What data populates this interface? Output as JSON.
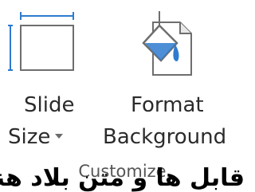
{
  "ribbon_group": {
    "name": "Customize",
    "buttons": [
      {
        "id": "slide_size",
        "icon": "slide-frame-icon",
        "label_line1": "Slide",
        "label_line2": "Size",
        "has_dropdown": true
      },
      {
        "id": "format_background",
        "icon": "paint-bucket-page-icon",
        "label_line1": "Format",
        "label_line2": "Background",
        "has_dropdown": false
      }
    ]
  },
  "overlay_caption": "قابل ها و متن بلاد هنا",
  "colors": {
    "icon_accent": "#2e7bcf",
    "icon_stroke": "#6e6e6e",
    "text": "#2b2b2b",
    "group_label": "#555555",
    "background": "#ffffff"
  }
}
